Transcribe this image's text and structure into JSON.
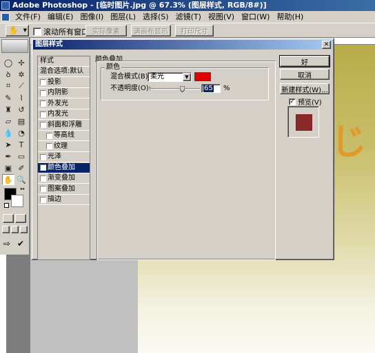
{
  "app": {
    "title": "Adobe Photoshop - [临时图片.jpg @ 67.3% (图层样式, RGB/8#)]"
  },
  "menu": {
    "items": [
      "文件(F)",
      "编辑(E)",
      "图像(I)",
      "图层(L)",
      "选择(S)",
      "滤镜(T)",
      "视图(V)",
      "窗口(W)",
      "帮助(H)"
    ]
  },
  "options_bar": {
    "scroll_all_label": "滚动所有窗口",
    "scroll_all_checked": false,
    "actual_pixels": "实际像素",
    "fit_on_screen": "满画布显示",
    "print_size": "打印尺寸"
  },
  "dialog": {
    "title": "图层样式",
    "style_list": {
      "header": "样式",
      "items": [
        {
          "label": "混合选项:默认",
          "checkbox": false,
          "checked": false,
          "indent": false,
          "selected": false
        },
        {
          "label": "投影",
          "checkbox": true,
          "checked": false,
          "indent": false,
          "selected": false
        },
        {
          "label": "内阴影",
          "checkbox": true,
          "checked": false,
          "indent": false,
          "selected": false
        },
        {
          "label": "外发光",
          "checkbox": true,
          "checked": false,
          "indent": false,
          "selected": false
        },
        {
          "label": "内发光",
          "checkbox": true,
          "checked": false,
          "indent": false,
          "selected": false
        },
        {
          "label": "斜面和浮雕",
          "checkbox": true,
          "checked": false,
          "indent": false,
          "selected": false
        },
        {
          "label": "等高线",
          "checkbox": true,
          "checked": false,
          "indent": true,
          "selected": false
        },
        {
          "label": "纹理",
          "checkbox": true,
          "checked": false,
          "indent": true,
          "selected": false
        },
        {
          "label": "光泽",
          "checkbox": true,
          "checked": false,
          "indent": false,
          "selected": false
        },
        {
          "label": "颜色叠加",
          "checkbox": true,
          "checked": true,
          "indent": false,
          "selected": true
        },
        {
          "label": "渐变叠加",
          "checkbox": true,
          "checked": false,
          "indent": false,
          "selected": false
        },
        {
          "label": "图案叠加",
          "checkbox": true,
          "checked": false,
          "indent": false,
          "selected": false
        },
        {
          "label": "描边",
          "checkbox": true,
          "checked": false,
          "indent": false,
          "selected": false
        }
      ]
    },
    "color_overlay": {
      "section_title": "颜色叠加",
      "group_title": "颜色",
      "blend_mode_label": "混合模式(B):",
      "blend_mode_value": "柔光",
      "overlay_color": "#e00000",
      "opacity_label": "不透明度(O):",
      "opacity_value": "65",
      "opacity_fraction": 0.65,
      "percent_sign": "%"
    },
    "buttons": {
      "ok": "好",
      "cancel": "取消",
      "new_style": "新建样式(W)..."
    },
    "preview": {
      "label": "预览(V)",
      "checked": true,
      "swatch_color": "#8b2a2a"
    }
  },
  "canvas": {
    "background_color": "#c0c0c0"
  },
  "toolbox": {
    "foreground_color": "#000000",
    "background_color": "#ffffff"
  }
}
